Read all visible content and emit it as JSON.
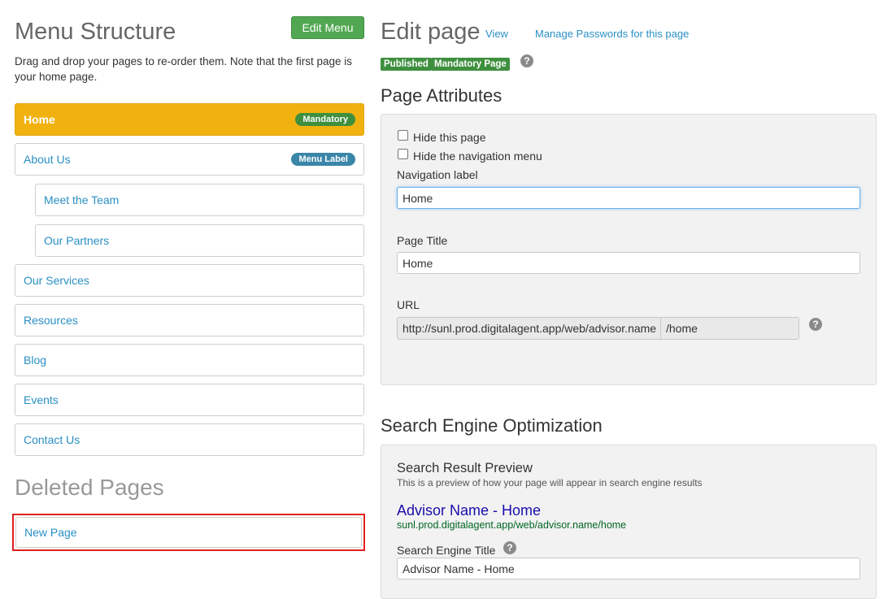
{
  "left": {
    "title": "Menu Structure",
    "edit_menu_label": "Edit Menu",
    "intro": "Drag and drop your pages to re-order them. Note that the first page is your home page.",
    "menu": [
      {
        "label": "Home",
        "badge": "Mandatory"
      },
      {
        "label": "About Us",
        "badge": "Menu Label"
      },
      {
        "label": "Meet the Team"
      },
      {
        "label": "Our Partners"
      },
      {
        "label": "Our Services"
      },
      {
        "label": "Resources"
      },
      {
        "label": "Blog"
      },
      {
        "label": "Events"
      },
      {
        "label": "Contact Us"
      }
    ],
    "deleted_title": "Deleted Pages",
    "deleted": [
      {
        "label": "New Page"
      }
    ]
  },
  "right": {
    "title": "Edit page",
    "view_link": "View",
    "passwords_link": "Manage Passwords for this page",
    "status_badges": [
      "Published",
      "Mandatory Page"
    ],
    "help_glyph": "?",
    "attributes": {
      "heading": "Page Attributes",
      "hide_page_label": "Hide this page",
      "hide_nav_label": "Hide the navigation menu",
      "nav_label_label": "Navigation label",
      "nav_label_value": "Home",
      "page_title_label": "Page Title",
      "page_title_value": "Home",
      "url_label": "URL",
      "url_prefix": "http://sunl.prod.digitalagent.app/web/advisor.name",
      "url_slug": "/home"
    },
    "seo": {
      "heading": "Search Engine Optimization",
      "preview_heading": "Search Result Preview",
      "preview_desc": "This is a preview of how your page will appear in search engine results",
      "preview_title": "Advisor Name - Home",
      "preview_url": "sunl.prod.digitalagent.app/web/advisor.name/home",
      "se_title_label": "Search Engine Title",
      "se_title_value": "Advisor Name - Home"
    }
  },
  "colors": {
    "accent_blue": "#2a8fc4",
    "active_orange": "#f1b20f",
    "badge_green": "#3e8f3e",
    "badge_blue": "#3a86a8",
    "highlight_red": "#e02020"
  }
}
